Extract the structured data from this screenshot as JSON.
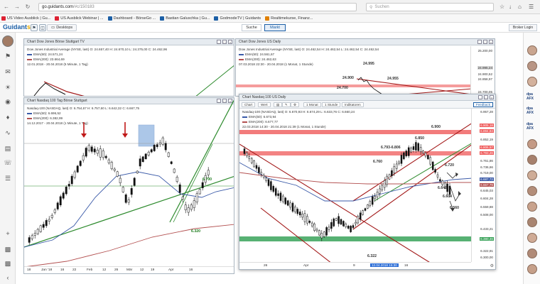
{
  "browser": {
    "url_host": "go.guidants.com",
    "url_path": "/#c/150183",
    "search_placeholder": "Suchen",
    "bookmarks": [
      {
        "label": "US Video Ausblick | Gu...",
        "color": "#d23"
      },
      {
        "label": "US Ausblick Webinar | ...",
        "color": "#d23"
      },
      {
        "label": "Dashboard - BörseGo ...",
        "color": "#1c5fa6"
      },
      {
        "label": "Bastian Galuschka | Gu...",
        "color": "#1c5fa6"
      },
      {
        "label": "GodmodeTV | Guidants",
        "color": "#1c5fa6"
      },
      {
        "label": "Realtimekurse, Finanz...",
        "color": "#e08000"
      }
    ]
  },
  "header": {
    "logo_main": "Guidant",
    "logo_dot": "s",
    "desktops_label": "Desktops",
    "suche_label": "Suche",
    "markt_label": "Markt",
    "login_label": "Broker Login"
  },
  "right_sidebar": {
    "logos": [
      "dpa AFX",
      "dpa AFX",
      "dpa AFX"
    ]
  },
  "colors": {
    "up": "#111111",
    "ema50": "#3a5aa8",
    "ema200": "#b35050",
    "channel_red": "#a31919",
    "trend_green": "#2e8b2e",
    "zone_red": "#ef5a5a",
    "zone_green": "#3aa35a"
  },
  "windows": {
    "dow_stuttgart": {
      "title": "Chart Dow Jones Börse Stuttgart TV",
      "legend": [
        "Dow Jones Industrial Average (NYSE, last) O: 24.657,40 H: 24.670,10 L: 24.375,00 C: 24.462,96",
        "EMA(50): 24.571,24",
        "EMA(200): 23.664,69",
        "12.01.2018 - 20.04.2018 (5 Minute, 1 Tag)"
      ]
    },
    "dow_us": {
      "title": "Chart Dow Jones US Daily",
      "legend": [
        "Dow Jones Industrial Average (NYSE, last) O: 24.462,54 H: 24.462,54 L: 24.462,54 C: 24.462,54",
        "EMA(50): 24.561,67",
        "EMA(200): 24.462,63",
        "07.03.2018 22:30 - 20.04.2018 (1 Monat, 1 Stunde)"
      ],
      "annotations": [
        "24.900",
        "24.955",
        "24.700",
        "24.995"
      ],
      "price_labels": [
        "25.200,00",
        "24.995,24",
        "24.900,52",
        "24.858,97",
        "24.700,05"
      ]
    },
    "nasdaq_stuttgart": {
      "title": "Chart Nasdaq 100 Tag Börse Stuttgart",
      "legend": [
        "Nasdaq-100 (NASDAQ, last) O: 6.754,67 H: 6.757,60 L: 6.642,32 C: 6.667,75",
        "EMA(50): 6.696,52",
        "EMA(200): 6.382,99",
        "14.12.2017 - 20.04.2018 (1 Minute, 1 Tag)"
      ],
      "annotations": [
        "6.700",
        "6.320"
      ],
      "dates": [
        "18",
        "Jan '18",
        "16",
        "22",
        "Feb",
        "12",
        "26",
        "Mär",
        "12",
        "19",
        "Apr",
        "16"
      ]
    },
    "nasdaq_us": {
      "title": "Chart Nasdaq 100 US Daily",
      "toolbar": [
        "Chart",
        "Wert",
        "1 Monat",
        "1 Stunde",
        "Indikatoren"
      ],
      "feedback": "Feedback",
      "legend": [
        "Nasdaq-100 (NASDAQ, last) O: 6.670,93 H: 6.674,29 L: 6.633,76 C: 6.660,24",
        "EMA(50): 6.673,94",
        "EMA(200): 6.677,77",
        "22.03.2018 14:30 - 20.04.2018 21:39 (1 Monat, 1 Stunde)"
      ],
      "annotations": [
        "6.900",
        "6.850",
        "6.793-6.806",
        "6.760",
        "6.720",
        "6.645",
        "6.604",
        "6.560",
        "6.322"
      ],
      "price_labels": [
        "6.957,28",
        "6.905,18",
        "6.894,84",
        "6.852,19",
        "6.806,57",
        "6.793,26",
        "6.761,86",
        "6.736,66",
        "6.719,00",
        "6.687,72",
        "6.667,79",
        "6.645,03",
        "6.604,28",
        "6.559,88",
        "6.508,00",
        "6.433,21",
        "6.380,46",
        "6.322,91",
        "6.300,00"
      ],
      "dates": [
        "26",
        "Apr",
        "9",
        "16"
      ],
      "crosshair_time": "12.04.2018 15:30"
    }
  }
}
